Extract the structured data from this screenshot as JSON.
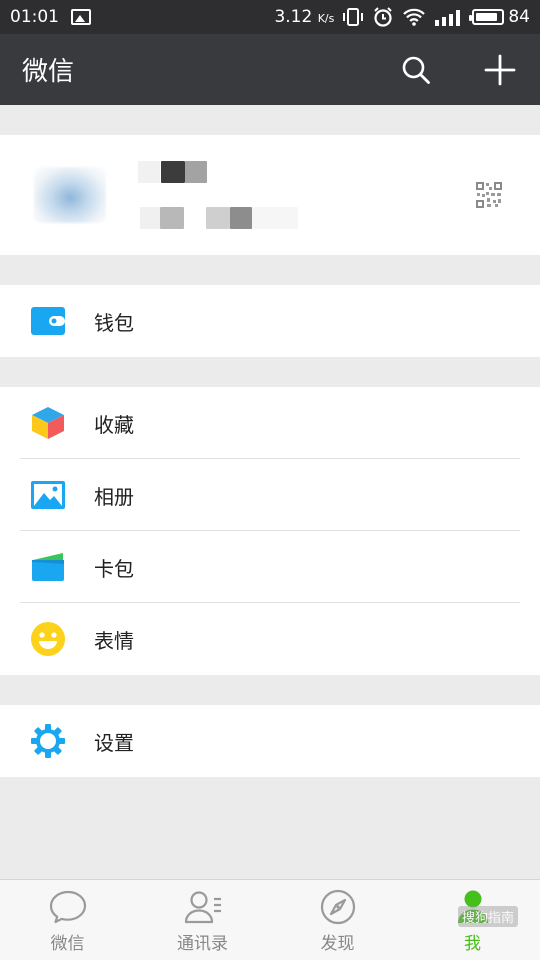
{
  "status_bar": {
    "time": "01:01",
    "speed": "3.12",
    "speed_unit": "K/s",
    "battery": "84"
  },
  "header": {
    "title": "微信",
    "search_icon": "search-icon",
    "add_icon": "plus-icon"
  },
  "menu": {
    "wallet": "钱包",
    "favorites": "收藏",
    "album": "相册",
    "cards": "卡包",
    "stickers": "表情",
    "settings": "设置"
  },
  "bottom_nav": [
    {
      "label": "微信",
      "icon": "chat-bubble-icon",
      "active": false
    },
    {
      "label": "通讯录",
      "icon": "contacts-icon",
      "active": false
    },
    {
      "label": "发现",
      "icon": "compass-icon",
      "active": false
    },
    {
      "label": "我",
      "icon": "person-icon",
      "active": true
    }
  ],
  "watermark": "搜狗指南",
  "colors": {
    "header_bg": "#393a3e",
    "status_bg": "#2e2e30",
    "accent_green": "#45c01a",
    "wallet_blue": "#1aa7f2",
    "emoji_yellow": "#fcd21b"
  }
}
